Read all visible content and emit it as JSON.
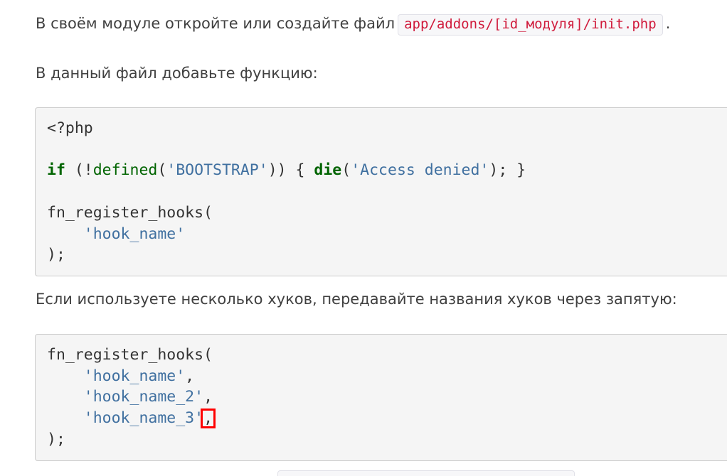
{
  "intro": {
    "text_before": "В своём модуле откройте или создайте файл",
    "file_path": "app/addons/[id_модуля]/init.php",
    "text_after": "."
  },
  "paragraph_add_function": "В данный файл добавьте функцию:",
  "code_block_1": {
    "line1": "<?php",
    "line3": {
      "kw_if": "if",
      "paren_open": " (!",
      "fn_defined": "defined",
      "paren_open2": "(",
      "str_bootstrap": "'BOOTSTRAP'",
      "close": ")) { ",
      "kw_die": "die",
      "paren_open3": "(",
      "str_access": "'Access denied'",
      "end": "); }"
    },
    "line5": "fn_register_hooks(",
    "line6_indent": "    ",
    "line6_str": "'hook_name'",
    "line7": ");"
  },
  "paragraph_multiple_hooks": "Если используете несколько хуков, передавайте названия хуков через запятую:",
  "code_block_2": {
    "line1": "fn_register_hooks(",
    "indent": "    ",
    "hook1": "'hook_name'",
    "hook2": "'hook_name_2'",
    "hook3": "'hook_name_3'",
    "comma": ",",
    "highlighted_comma": ",",
    "line_end": ");"
  }
}
